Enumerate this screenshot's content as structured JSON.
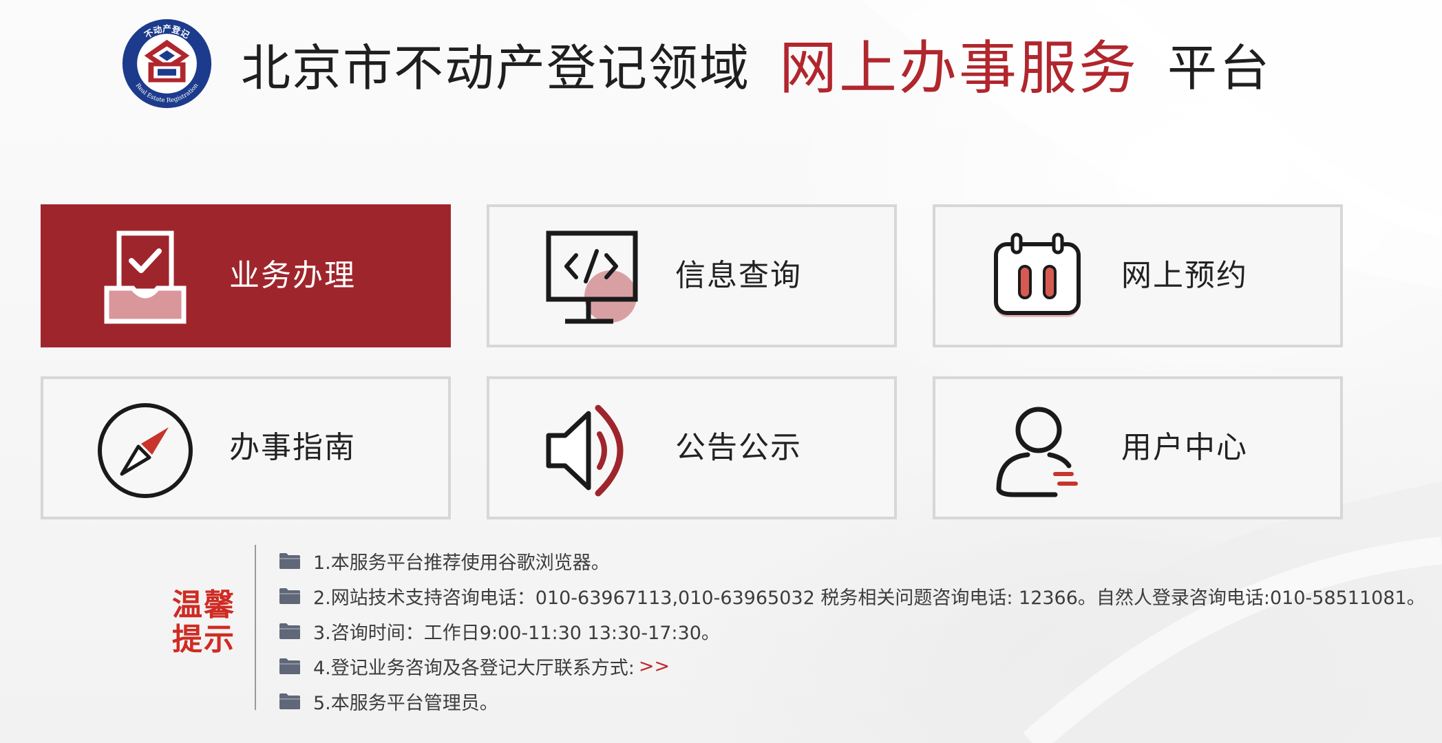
{
  "header": {
    "logo_top_text": "不动产登记",
    "logo_bottom_text": "Real Estate Registration",
    "title_main": "北京市不动产登记领域",
    "title_accent": "网上办事服务",
    "title_suffix": "平台"
  },
  "colors": {
    "accent": "#9f252c",
    "accent_text": "#b1262d",
    "tip_heading": "#cf2b23",
    "link": "#c0282a",
    "tile_border": "#d7d7d7"
  },
  "tiles": [
    {
      "label": "业务办理",
      "icon": "checked-inbox-icon",
      "active": true
    },
    {
      "label": "信息查询",
      "icon": "monitor-code-icon",
      "active": false
    },
    {
      "label": "网上预约",
      "icon": "calendar-icon",
      "active": false
    },
    {
      "label": "办事指南",
      "icon": "compass-icon",
      "active": false
    },
    {
      "label": "公告公示",
      "icon": "speaker-icon",
      "active": false
    },
    {
      "label": "用户中心",
      "icon": "user-icon",
      "active": false
    }
  ],
  "tips": {
    "heading_line1": "温馨",
    "heading_line2": "提示",
    "items": [
      {
        "text": "1.本服务平台推荐使用谷歌浏览器。"
      },
      {
        "text": "2.网站技术支持咨询电话：010-63967113,010-63965032 税务相关问题咨询电话: 12366。自然人登录咨询电话:010-58511081。"
      },
      {
        "text": "3.咨询时间：工作日9:00-11:30 13:30-17:30。"
      },
      {
        "text": "4.登记业务咨询及各登记大厅联系方式: ",
        "link": ">>"
      },
      {
        "text": "5.本服务平台管理员。"
      }
    ]
  }
}
